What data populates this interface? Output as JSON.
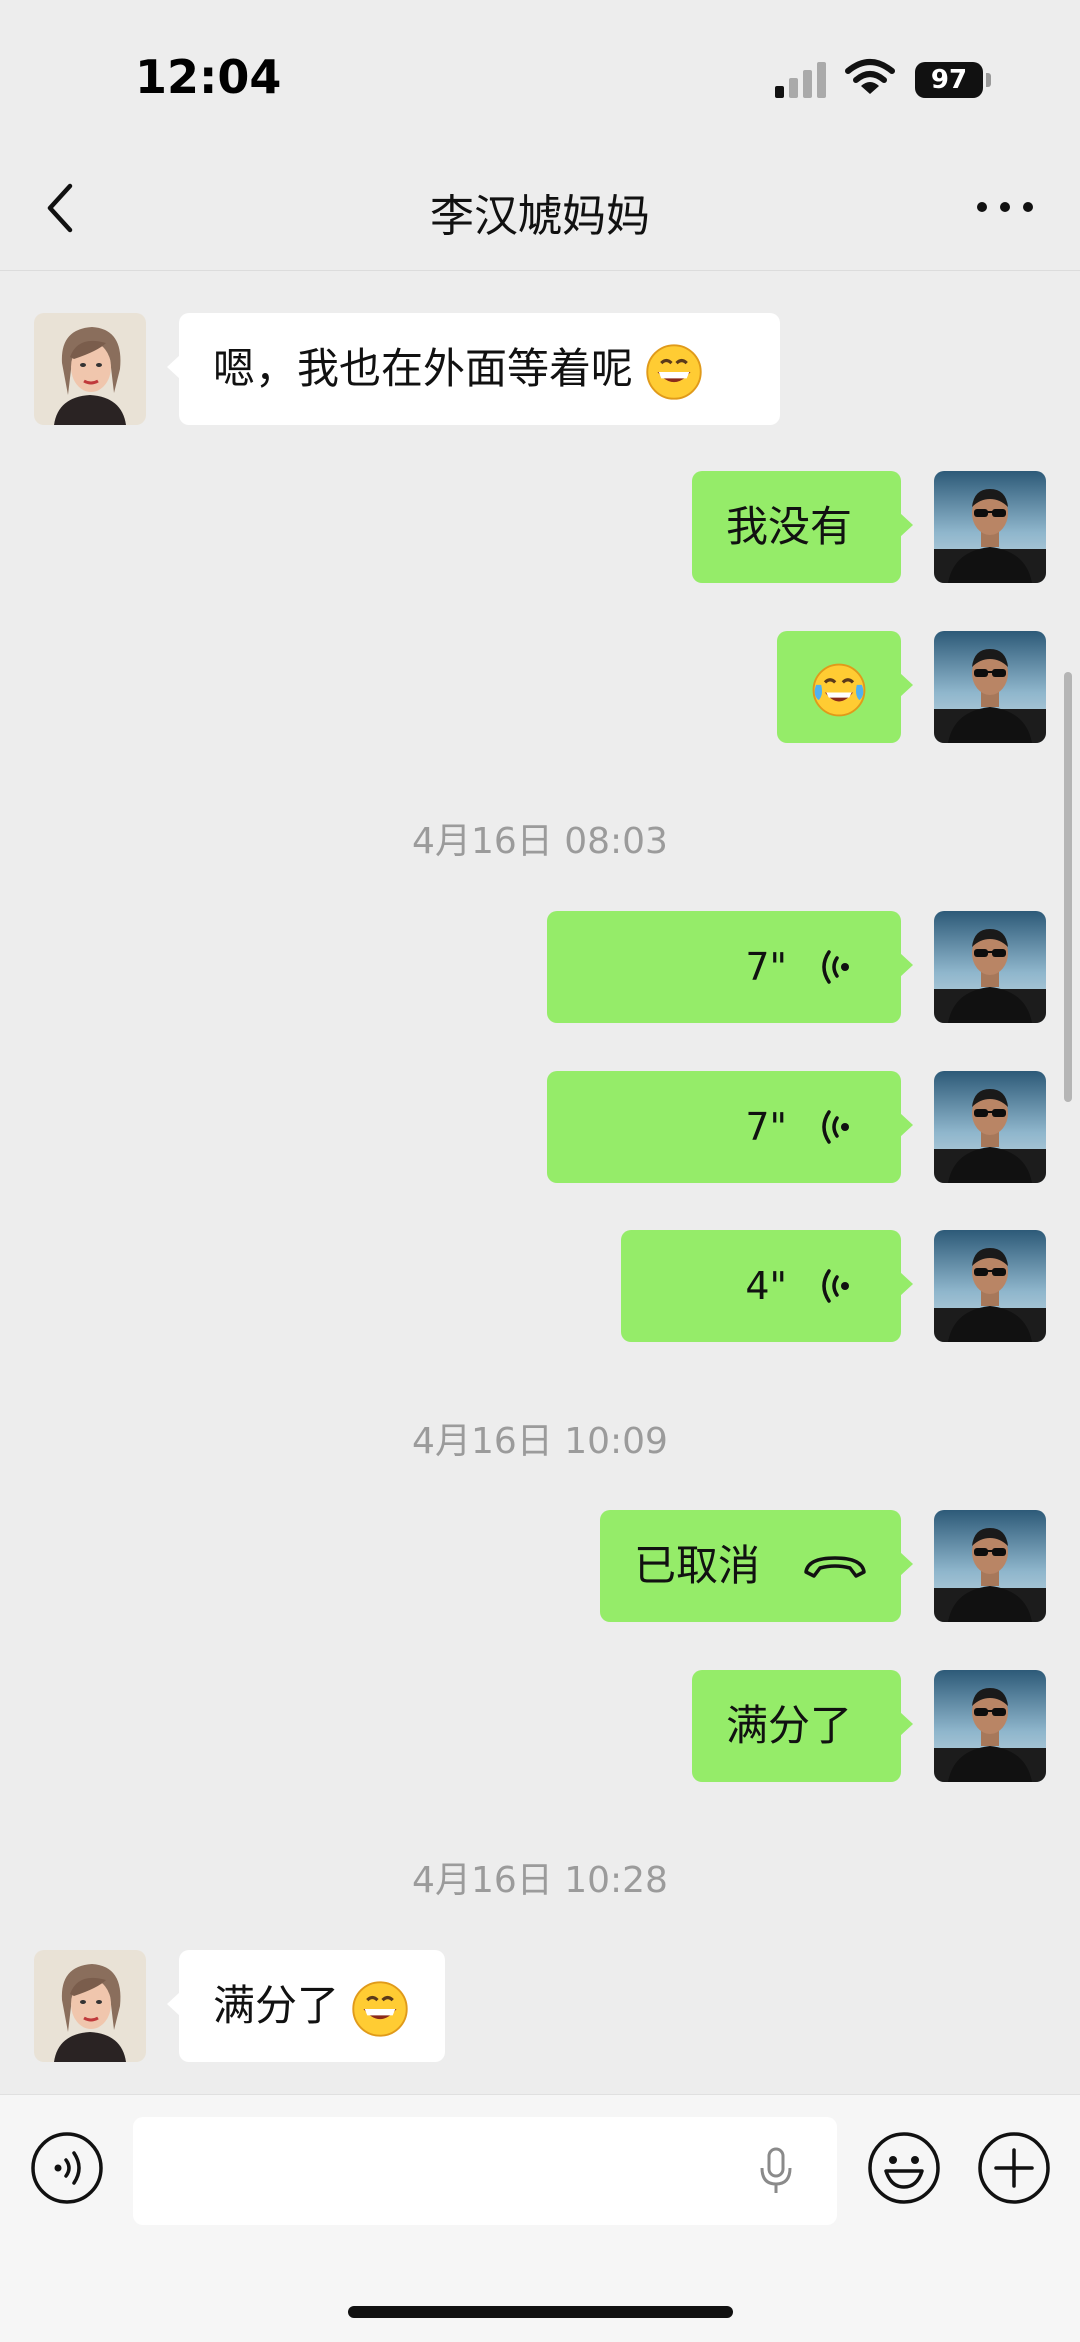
{
  "status_bar": {
    "time": "12:04",
    "battery": "97"
  },
  "header": {
    "title": "李汉虓妈妈"
  },
  "messages": [
    {
      "text": "嗯，我也在外面等着呢",
      "emoji": "grinning-face-emoji"
    },
    {
      "text": "我没有"
    },
    {
      "emoji": "tears-of-joy-emoji"
    },
    {
      "text": "满分了",
      "emoji": "grinning-face-emoji"
    }
  ],
  "timestamps": [
    "4月16日 08:03",
    "4月16日 10:09",
    "4月16日 10:28"
  ],
  "voice_messages": [
    "7\"",
    "7\"",
    "4\""
  ],
  "call": {
    "text": "已取消",
    "icon": "hang-up-phone-icon"
  },
  "last_out": {
    "text": "满分了"
  },
  "colors": {
    "out_bubble": "#95ec69",
    "in_bubble": "#ffffff",
    "background": "#ededed"
  },
  "icons": [
    "back-chevron-icon",
    "more-dots-icon",
    "voice-input-icon",
    "microphone-icon",
    "emoji-icon",
    "plus-icon",
    "signal-icon",
    "wifi-icon",
    "battery-icon"
  ]
}
